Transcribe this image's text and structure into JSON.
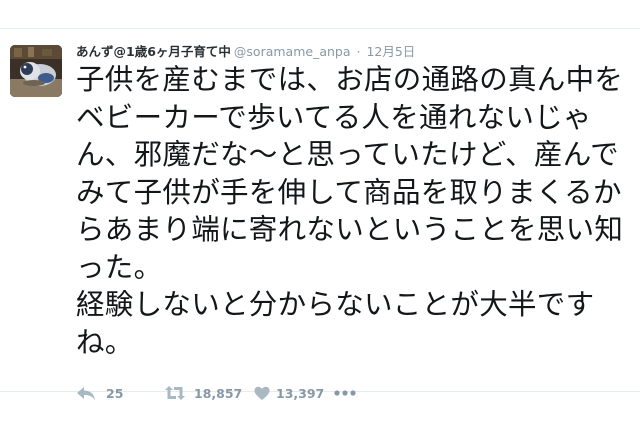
{
  "tweet": {
    "display_name": "あんず@1歳6ヶ月子育て中",
    "handle": "@soramame_anpa",
    "separator": "·",
    "timestamp": "12月5日",
    "text": "子供を産むまでは、お店の通路の真ん中を\nベビーカーで歩いてる人を通れないじゃ\nん、邪魔だな〜と思っていたけど、産んで\nみて子供が手を伸して商品を取りまくるか\nらあまり端に寄れないということを思い知\nった。\n経験しないと分からないことが大半です\nね。",
    "actions": {
      "reply_count": "25",
      "retweet_count": "18,857",
      "like_count": "13,397"
    }
  },
  "icons": {
    "reply": "reply-arrow-icon",
    "retweet": "retweet-icon",
    "like": "heart-icon",
    "more": "more-dots-icon"
  },
  "colors": {
    "text": "#14171a",
    "secondary": "#8899a6",
    "icon": "#aab8c2",
    "border": "#e6ecf0"
  }
}
